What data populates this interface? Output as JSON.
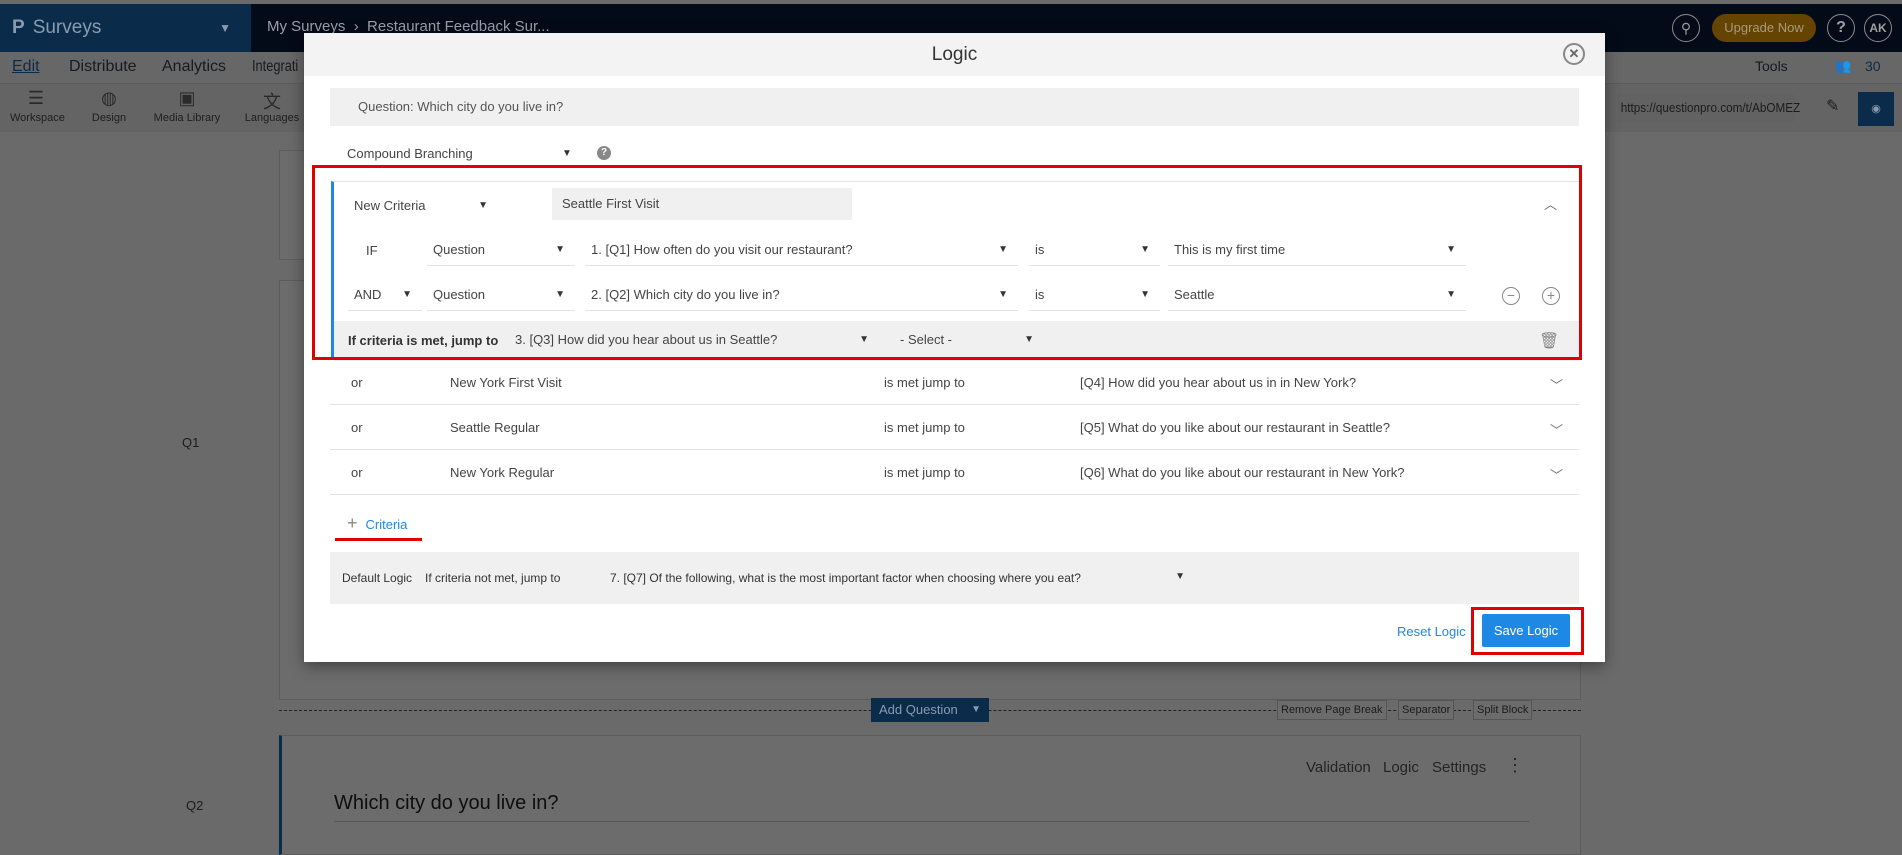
{
  "app": {
    "brand": "Surveys",
    "breadcrumb": [
      "My Surveys",
      "Restaurant Feedback Sur..."
    ],
    "upgrade": "Upgrade Now",
    "avatar": "AK",
    "help": "?"
  },
  "nav": {
    "items": [
      "Edit",
      "Distribute",
      "Analytics",
      "Integrati"
    ],
    "tools": "Tools",
    "count": "30"
  },
  "toolbar": {
    "items": [
      "Workspace",
      "Design",
      "Media Library",
      "Languages"
    ],
    "url": "https://questionpro.com/t/AbOMEZ"
  },
  "background": {
    "q1": "Q1",
    "q2": "Q2",
    "q2_title": "Which city do you live in?",
    "add_question": "Add Question",
    "remove_page_break": "Remove Page Break",
    "separator": "Separator",
    "split_block": "Split Block",
    "actions": [
      "Validation",
      "Logic",
      "Settings"
    ]
  },
  "modal": {
    "title": "Logic",
    "question": "Question: Which city do you live in?",
    "logic_type": "Compound Branching",
    "criteria": {
      "type": "New Criteria",
      "name": "Seattle First Visit",
      "conditions": [
        {
          "connector": "IF",
          "source": "Question",
          "question": "1. [Q1] How often do you visit our restaurant?",
          "operator": "is",
          "value": "This is my first time"
        },
        {
          "connector": "AND",
          "source": "Question",
          "question": "2. [Q2] Which city do you live in?",
          "operator": "is",
          "value": "Seattle"
        }
      ],
      "jump_label": "If criteria is met, jump to",
      "jump_target": "3. [Q3] How did you hear about us in Seattle?",
      "jump_select": "- Select -"
    },
    "other_criteria": [
      {
        "connector": "or",
        "name": "New York First Visit",
        "met": "is met jump to",
        "target": "[Q4] How did you hear about us in in New York?"
      },
      {
        "connector": "or",
        "name": "Seattle Regular",
        "met": "is met jump to",
        "target": "[Q5] What do you like about our restaurant in Seattle?"
      },
      {
        "connector": "or",
        "name": "New York Regular",
        "met": "is met jump to",
        "target": "[Q6] What do you like about our restaurant in New York?"
      }
    ],
    "add_criteria": "Criteria",
    "default_logic": {
      "label": "Default Logic",
      "text": "If criteria not met, jump to",
      "target": "7. [Q7] Of the following, what is the most important factor when choosing where you eat?"
    },
    "reset": "Reset Logic",
    "save": "Save Logic"
  },
  "colors": {
    "accent": "#1e88e5",
    "highlight": "#e00000",
    "upgrade": "#f0a000"
  }
}
